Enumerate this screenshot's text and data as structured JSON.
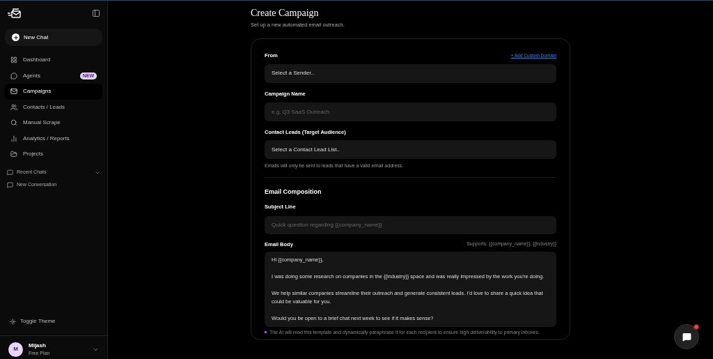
{
  "sidebar": {
    "new_chat": "New Chat",
    "nav": [
      {
        "label": "Dashboard",
        "selected": false
      },
      {
        "label": "Agents",
        "selected": false,
        "badge": "NEW"
      },
      {
        "label": "Campaigns",
        "selected": true
      },
      {
        "label": "Contacts / Leads",
        "selected": false
      },
      {
        "label": "Manual Scrape",
        "selected": false
      },
      {
        "label": "Analytics / Reports",
        "selected": false
      },
      {
        "label": "Projects",
        "selected": false
      }
    ],
    "recent": {
      "title": "Recent Chats",
      "expanded": true,
      "items": [
        "New Conversation"
      ]
    },
    "toggle_theme": "Toggle Theme",
    "user": {
      "initial": "M",
      "name": "Mijash",
      "plan": "Free Plan"
    }
  },
  "page": {
    "title": "Create Campaign",
    "subtitle": "Set up a new automated email outreach."
  },
  "form": {
    "fields": [
      {
        "label": "From",
        "link": "+ Add Custom Domain",
        "kind": "select",
        "value": "Select a Sender.."
      },
      {
        "label": "Campaign Name",
        "kind": "input",
        "placeholder": "e.g. Q3 SaaS Outreach"
      },
      {
        "label": "Contact Leads (Target Audience)",
        "kind": "select",
        "value": "Select a Contact Lead List..",
        "help": "Emails will only be sent to leads that have a valid email address."
      }
    ],
    "section": "Email Composition",
    "subject": {
      "label": "Subject Line",
      "placeholder": "Quick question regarding {{company_name}}"
    },
    "body": {
      "label": "Email Body",
      "hint": "Supports: {{company_name}}, {{industry}}",
      "value": "Hi {{company_name}},\n\nI was doing some research on companies in the {{industry}} space and was really impressed by the work you're doing.\n\nWe help similar companies streamline their outreach and generate consistent leads. I'd love to share a quick idea that could be valuable for you.\n\nWould you be open to a brief chat next week to see if it makes sense?"
    },
    "note": "The AI will read this template and dynamically paraphrase it for each recipient to ensure high deliverability to primary inboxes."
  },
  "chat_button": {
    "unread": true
  }
}
